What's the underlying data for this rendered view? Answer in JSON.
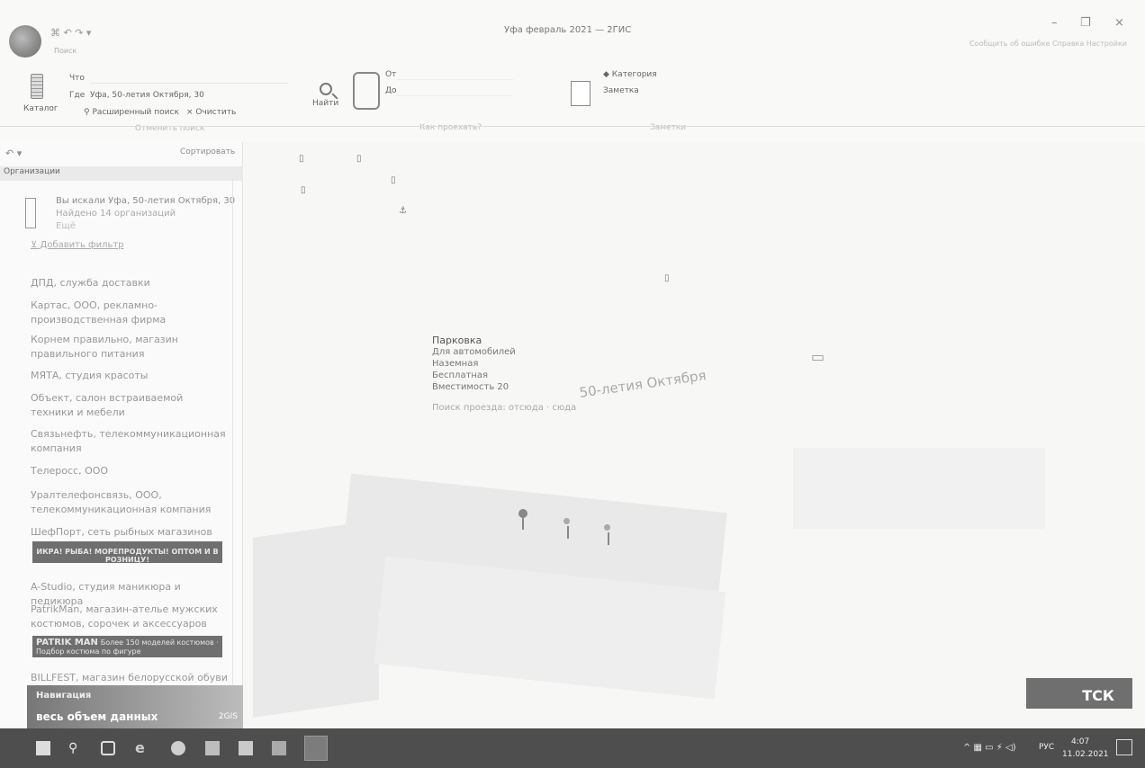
{
  "titlebar": {
    "qat": "⌘ ↶ ↷ ▾",
    "tab": "Поиск",
    "title": "Уфа февраль 2021 — 2ГИС",
    "links": "Сообщить об ошибке   Справка   Настройки"
  },
  "ribbon": {
    "catalog": "Каталог",
    "what_label": "Что",
    "where_label": "Где",
    "where_value": "Уфа, 50-летия Октября, 30",
    "advanced_search": "Расширенный поиск",
    "clear": "Очистить",
    "search_history": "Отменить поиск",
    "find": "Найти",
    "from": "От",
    "to": "До",
    "how_to_get": "Как проехать?",
    "category": "Категория",
    "note": "Заметка",
    "notes_group": "Заметки"
  },
  "sidebar": {
    "toolbar_left": "↶ ▾",
    "toolbar_right": "Сортировать",
    "section_title": "Организации",
    "search_summary": {
      "you_searched": "Вы искали Уфа, 50-летия Октября, 30",
      "found": "Найдено 14 организаций",
      "more": "Ещё"
    },
    "add_filter": "Добавить фильтр",
    "orgs": [
      "ДПД, служба доставки",
      "Картас, ООО, рекламно-производственная фирма",
      "Корнем правильно, магазин правильного питания",
      "МЯТА, студия красоты",
      "Объект, салон встраиваемой техники и мебели",
      "Связьнефть, телекоммуникационная компания",
      "Телеросс, ООО",
      "Уралтелефонсвязь, ООО, телекоммуникационная компания",
      "ШефПорт, сеть рыбных магазинов",
      "A-Studio, студия маникюра и педикюра",
      "PatrikMan, магазин-ателье мужских костюмов, сорочек и аксессуаров",
      "BILLFEST, магазин белорусской обуви"
    ],
    "ad_shefport": "ИКРА! РЫБА! МОРЕПРОДУКТЫ! ОПТОМ И В РОЗНИЦУ!",
    "ad_patrikman_brand": "PATRIK MAN",
    "ad_patrikman": "Более 150 моделей костюмов · Подбор костюма по фигуре",
    "bottom_ad_1": "Навигация",
    "bottom_ad_2": "весь объем данных",
    "bottom_ad_3": "2GIS"
  },
  "map": {
    "popup": {
      "title": "Парковка",
      "line1": "Для автомобилей",
      "line2": "Наземная",
      "line3": "Бесплатная",
      "line4": "Вместимость 20",
      "link": "Поиск проезда: отсюда · сюда"
    },
    "street": "50-летия Октября",
    "badge": "ТСК"
  },
  "taskbar": {
    "lang": "РУС",
    "time": "4:07",
    "date": "11.02.2021"
  }
}
